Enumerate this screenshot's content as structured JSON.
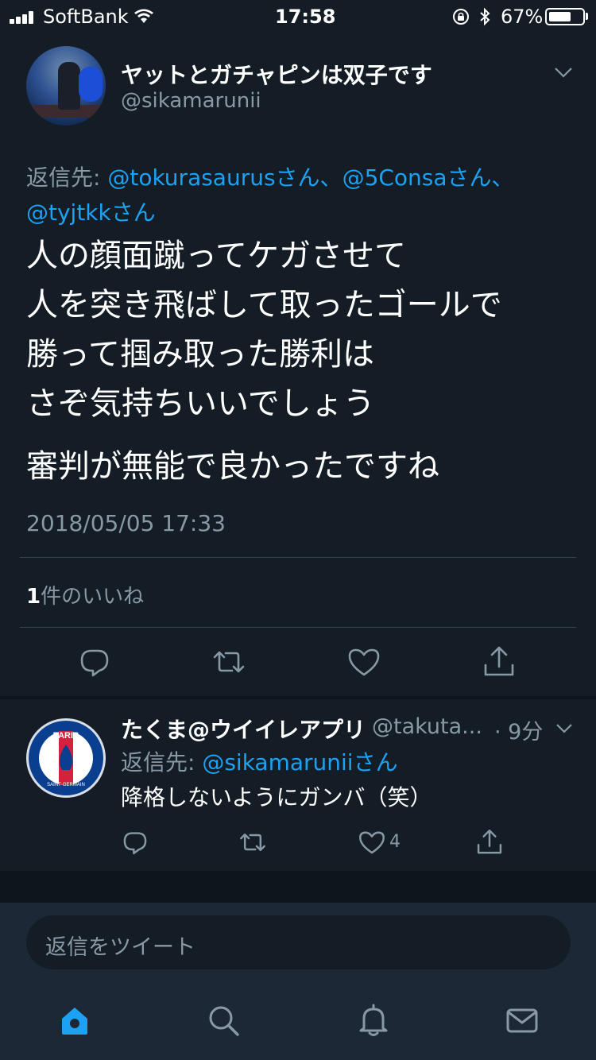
{
  "status_bar": {
    "carrier": "SoftBank",
    "time": "17:58",
    "battery": "67%",
    "battery_level": 0.67
  },
  "main_tweet": {
    "display_name": "ヤットとガチャピンは双子です",
    "handle": "@sikamarunii",
    "reply_prefix": "返信先: ",
    "reply_links": [
      "@tokurasaurusさん、",
      "@5Consaさん、",
      "@tyjtkkさん"
    ],
    "body_lines": "人の顔面蹴ってケガさせて\n人を突き飛ばして取ったゴールで\n勝って掴み取った勝利は\nさぞ気持ちいいでしょう",
    "body_last": "審判が無能で良かったですね",
    "timestamp": "2018/05/05 17:33",
    "likes_count": "1",
    "likes_label": "件のいいね"
  },
  "reply_tweet": {
    "display_name": "たくま@ウイイレアプリ",
    "handle": "@takuta...",
    "time": "· 9分",
    "reply_prefix": "返信先: ",
    "reply_link": "@sikamaruniiさん",
    "text": "降格しないようにガンバ（笑）",
    "like_count": "4"
  },
  "compose": {
    "placeholder": "返信をツイート"
  },
  "icons": {
    "accent": "#1da1f2",
    "muted": "#8899a6",
    "tabs": [
      "home-icon",
      "search-icon",
      "notifications-icon",
      "messages-icon"
    ]
  }
}
